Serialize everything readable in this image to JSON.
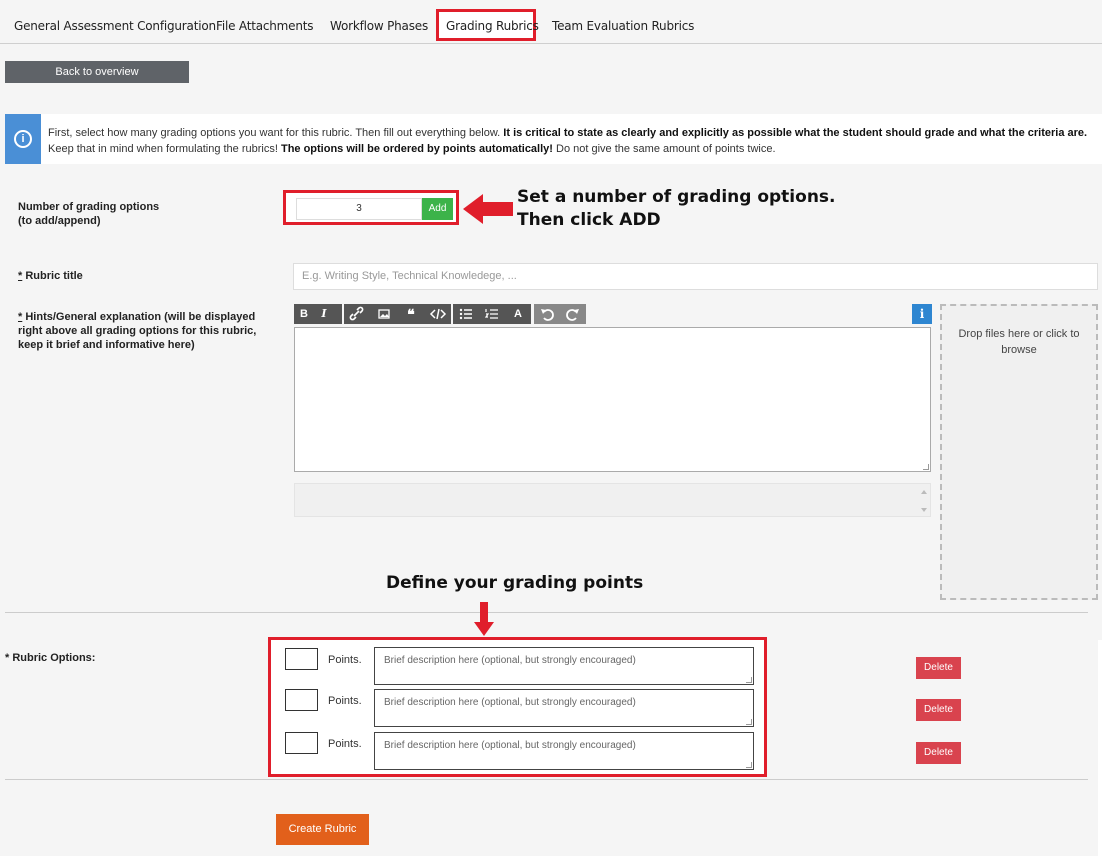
{
  "tabs": [
    {
      "label": "General Assessment Configuration"
    },
    {
      "label": "File Attachments"
    },
    {
      "label": "Workflow Phases"
    },
    {
      "label": "Grading Rubrics"
    },
    {
      "label": "Team Evaluation Rubrics"
    }
  ],
  "active_tab": "Grading Rubrics",
  "back_button": "Back to overview",
  "info": {
    "part1": "First, select how many grading options you want for this rubric. Then fill out everything below. ",
    "bold1": "It is critical to state as clearly and explicitly as possible what the student should grade and what the criteria are.",
    "part2": " Keep that in mind when formulating the rubrics! ",
    "bold2": "The options will be ordered by points automatically!",
    "part3": " Do not give the same amount of points twice."
  },
  "grading_options": {
    "label_line1": "Number of grading options",
    "label_line2": "(to add/append)",
    "value": "3",
    "add_label": "Add"
  },
  "callout": {
    "line1": "Set a number of grading options.",
    "line2": "Then click ADD"
  },
  "rubric_title": {
    "label": "Rubric title",
    "required_mark": "*",
    "placeholder": "E.g. Writing Style, Technical Knowledege, ..."
  },
  "hints": {
    "required_mark": "*",
    "label_line1": "Hints/General explanation (will be displayed",
    "label_line2": "right above all grading options for this rubric,",
    "label_line3": "keep it brief and informative here)"
  },
  "toolbar": {
    "bold": "B",
    "italic": "I",
    "info": "i"
  },
  "dropzone": "Drop files here or click to browse",
  "define_title": "Define your grading points",
  "rubric_options": {
    "label": "* Rubric Options:",
    "points_label": "Points.",
    "desc_placeholder": "Brief description here (optional, but strongly encouraged)",
    "delete_label": "Delete",
    "count": 3
  },
  "create_button": "Create Rubric",
  "colors": {
    "highlight": "#e01e2b",
    "add": "#3cb34a",
    "delete": "#d9434e",
    "create": "#e2601b",
    "info": "#4a8fd6"
  }
}
